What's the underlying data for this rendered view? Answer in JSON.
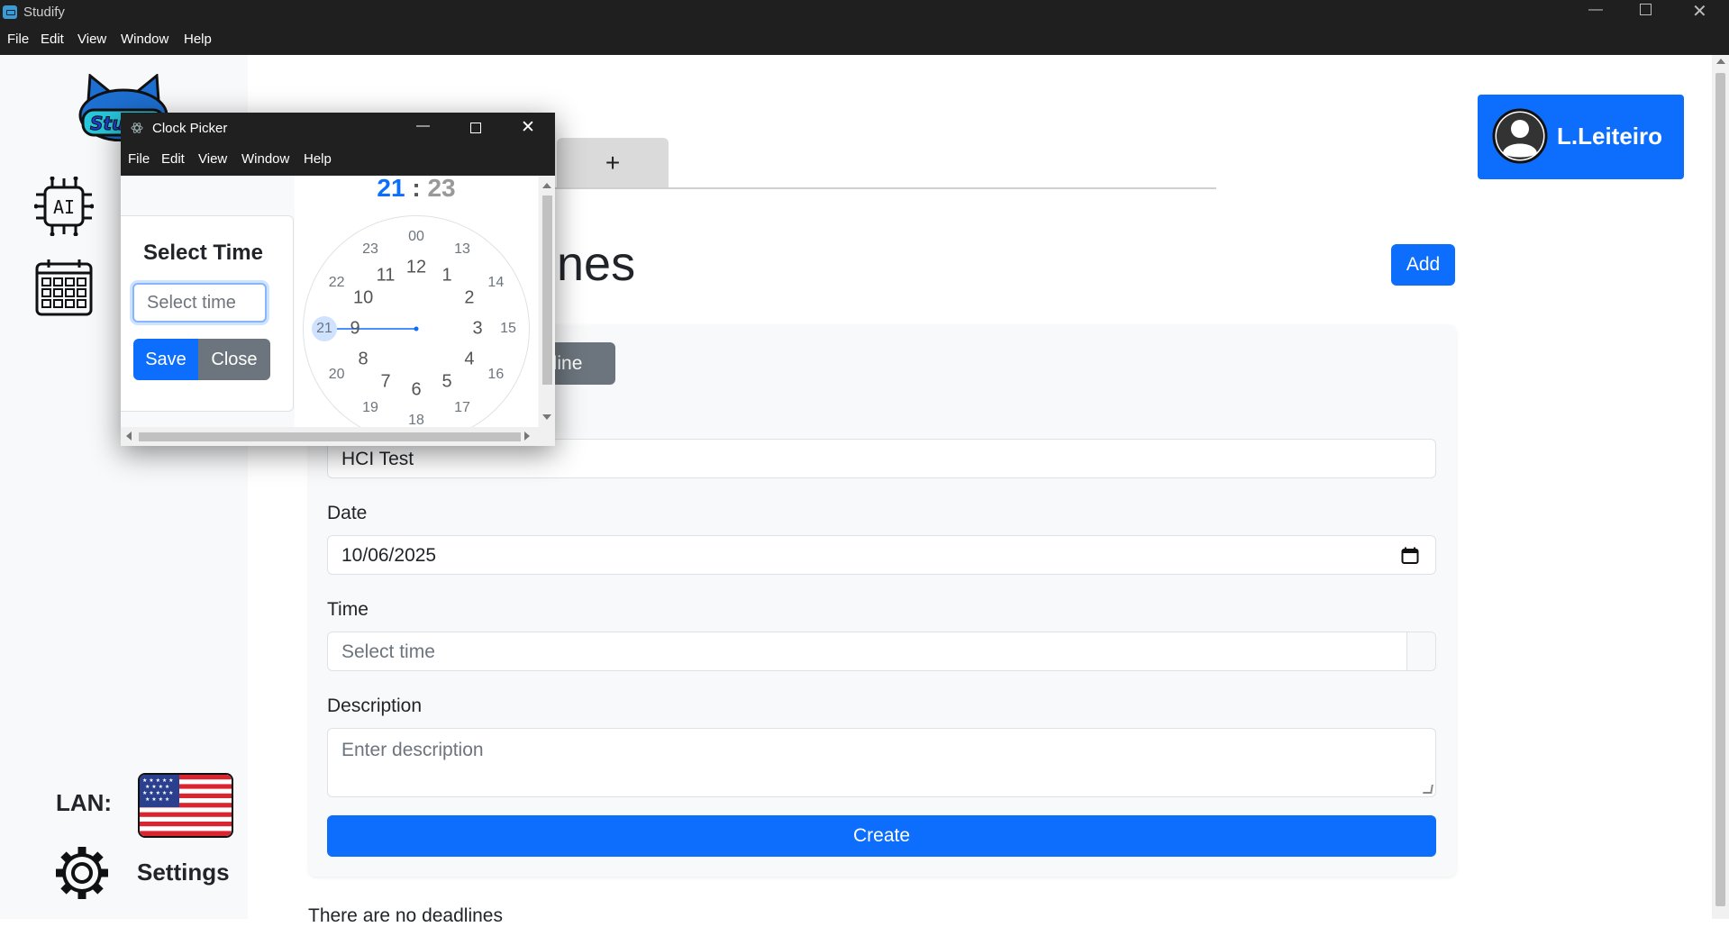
{
  "app": {
    "title": "Studify"
  },
  "menu": [
    "File",
    "Edit",
    "View",
    "Window",
    "Help"
  ],
  "profile": {
    "name": "L.Leiteiro"
  },
  "tabs": {
    "add_label": "+"
  },
  "page": {
    "heading": "nes",
    "add_button": "Add",
    "tag_button": "dline"
  },
  "form": {
    "title_value": "HCI Test",
    "date_label": "Date",
    "date_value": "10/06/2025",
    "time_label": "Time",
    "time_placeholder": "Select time",
    "description_label": "Description",
    "description_placeholder": "Enter description",
    "create_button": "Create"
  },
  "empty_message": "There are no deadlines",
  "sidebar": {
    "lan_label": "LAN:",
    "settings_label": "Settings",
    "ai_label": "AI"
  },
  "clock_picker": {
    "window_title": "Clock Picker",
    "menu": [
      "File",
      "Edit",
      "View",
      "Window",
      "Help"
    ],
    "heading": "Select Time",
    "input_placeholder": "Select time",
    "save_button": "Save",
    "close_button": "Close",
    "hour": "21",
    "separator": ":",
    "minute": "23",
    "hours_12": [
      "12",
      "1",
      "2",
      "3",
      "4",
      "5",
      "6",
      "7",
      "8",
      "9",
      "10",
      "11"
    ],
    "hours_24": [
      "00",
      "13",
      "14",
      "15",
      "16",
      "17",
      "18",
      "19",
      "20",
      "21",
      "22",
      "23"
    ],
    "selected_hour": "21"
  },
  "colors": {
    "primary": "#0d6efd",
    "secondary": "#6c757d",
    "titlebar": "#1f1f1f"
  }
}
